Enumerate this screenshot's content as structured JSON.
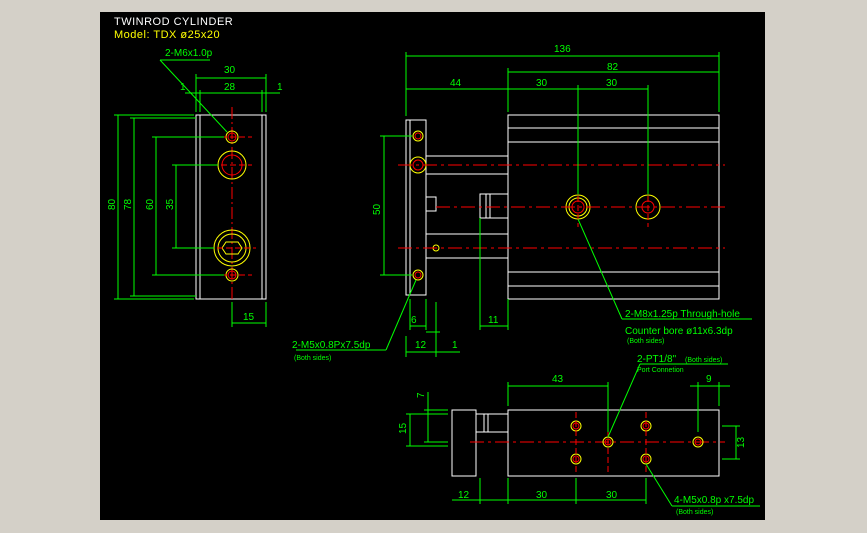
{
  "title": "TWINROD CYLINDER",
  "model": "Model: TDX ø25x20",
  "colors": {
    "background": "#000000",
    "frame": "#d4d0c8",
    "outline": "#ffffff",
    "dimension": "#00ff00",
    "center": "#ff0000",
    "feature": "#ffff00"
  },
  "notes": {
    "m6": "2-M6x1.0p",
    "m5_08": "2-M5x0.8Px7.5dp",
    "m5_both": "(Both sides)",
    "m8": "2-M8x1.25p Through-hole",
    "counterbore": "Counter bore ø11x6.3dp",
    "m8_both": "(Both sides)",
    "pt": "2-PT1/8\"",
    "pt_both": "(Both sides)",
    "port": "Port Connetion",
    "m5_4": "4-M5x0.8p x7.5dp",
    "m5_4_both": "(Both sides)"
  },
  "dims": {
    "d30": "30",
    "d28": "28",
    "d1a": "1",
    "d1b": "1",
    "d80": "80",
    "d78": "78",
    "d60": "60",
    "d35": "35",
    "d15": "15",
    "d136": "136",
    "d82": "82",
    "d44": "44",
    "d30b": "30",
    "d30c": "30",
    "d50": "50",
    "d6": "6",
    "d11": "11",
    "d12": "12",
    "d1c": "1",
    "d43": "43",
    "d9": "9",
    "d7": "7",
    "d15b": "15",
    "d13": "13",
    "d12b": "12",
    "d30d": "30",
    "d30e": "30"
  }
}
